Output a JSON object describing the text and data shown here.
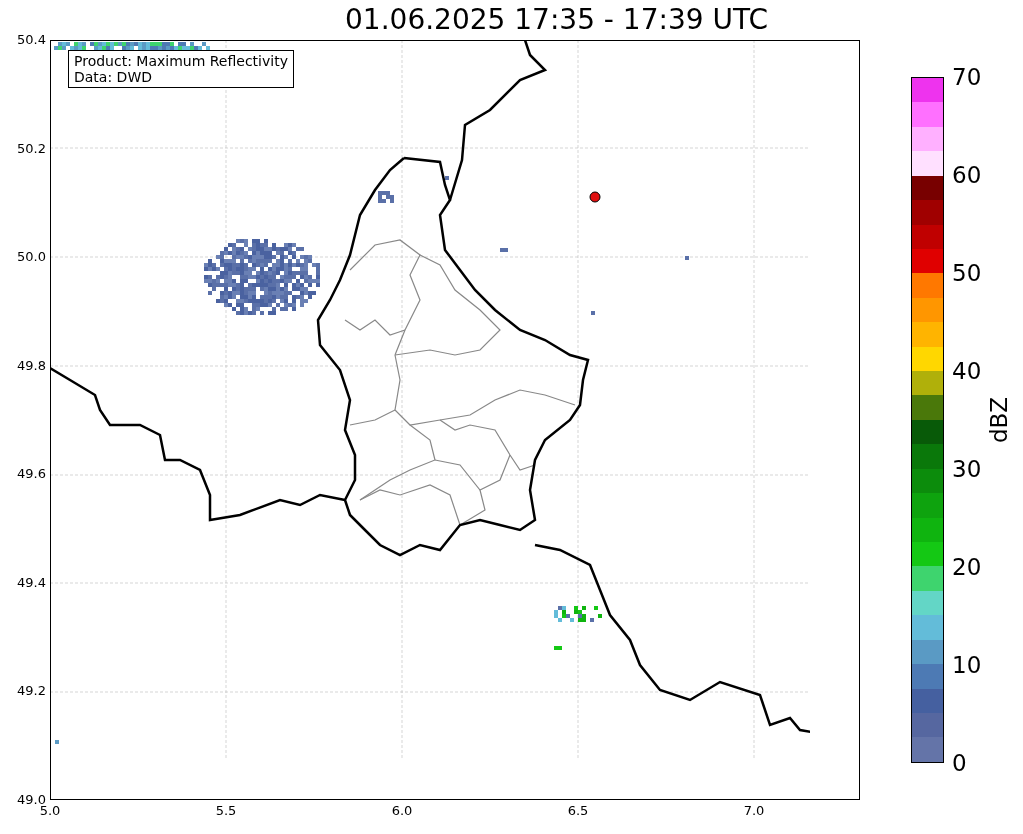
{
  "title": "01.06.2025 17:35 - 17:39 UTC",
  "legend": {
    "lines": [
      "Product: Maximum Reflectivity",
      "Data: DWD"
    ]
  },
  "y_axis": {
    "ticks": [
      "50.4",
      "50.2",
      "50.0",
      "49.8",
      "49.6",
      "49.4",
      "49.2",
      "49.0"
    ]
  },
  "x_axis": {
    "ticks": [
      "5.0",
      "5.5",
      "6.0",
      "6.5",
      "7.0"
    ]
  },
  "colorbar": {
    "label": "dBZ",
    "ticks": [
      "70",
      "60",
      "50",
      "40",
      "30",
      "20",
      "10",
      "0"
    ],
    "segments": [
      {
        "color": "#ee33ee"
      },
      {
        "color": "#ff70ff"
      },
      {
        "color": "#ffb0ff"
      },
      {
        "color": "#ffe0ff"
      },
      {
        "color": "#780000"
      },
      {
        "color": "#a00000"
      },
      {
        "color": "#c00000"
      },
      {
        "color": "#e00000"
      },
      {
        "color": "#ff7800"
      },
      {
        "color": "#ff9600"
      },
      {
        "color": "#ffb400"
      },
      {
        "color": "#ffd700"
      },
      {
        "color": "#b0b00a"
      },
      {
        "color": "#4a780a"
      },
      {
        "color": "#085a08"
      },
      {
        "color": "#0a780a"
      },
      {
        "color": "#0c8c0c"
      },
      {
        "color": "#0ea30e"
      },
      {
        "color": "#0fb40f"
      },
      {
        "color": "#14c814"
      },
      {
        "color": "#3ed46e"
      },
      {
        "color": "#63d6c6"
      },
      {
        "color": "#63bcd9"
      },
      {
        "color": "#5a9ac4"
      },
      {
        "color": "#4d7ab4"
      },
      {
        "color": "#4560a0"
      },
      {
        "color": "#5667a0"
      },
      {
        "color": "#6474a8"
      }
    ]
  }
}
